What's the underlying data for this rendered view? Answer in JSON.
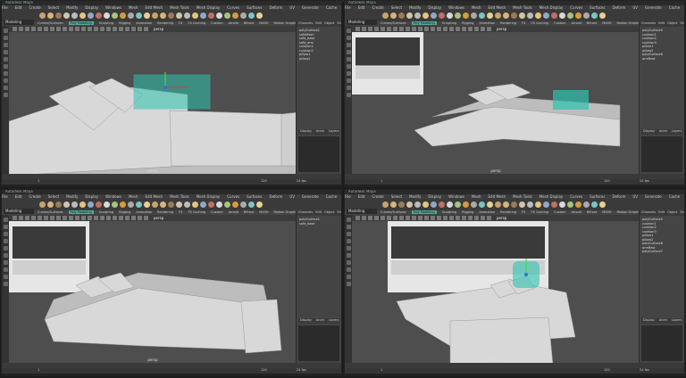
{
  "app": {
    "title_text": "Autodesk Maya",
    "mode": "Modeling",
    "menu": [
      "File",
      "Edit",
      "Create",
      "Select",
      "Modify",
      "Display",
      "Windows",
      "Mesh",
      "Edit Mesh",
      "Mesh Tools",
      "Mesh Display",
      "Curves",
      "Surfaces",
      "Deform",
      "UV",
      "Generate",
      "Cache",
      "Arnold",
      "Help"
    ],
    "shelf_tabs": [
      "Curves/Surfaces",
      "Poly Modeling",
      "Sculpting",
      "Rigging",
      "Animation",
      "Rendering",
      "FX",
      "FX Caching",
      "Custom",
      "Arnold",
      "Bifrost",
      "MASH",
      "Motion Graphics",
      "XGen"
    ],
    "active_shelf": "Poly Modeling",
    "camera": "persp",
    "channel_tabs": [
      "Channels",
      "Edit",
      "Object",
      "Show"
    ],
    "layer_tabs": [
      "Display",
      "Anim"
    ],
    "layer_menu": [
      "Layers",
      "Options",
      "Help"
    ],
    "range_start": "1",
    "range_end": "120",
    "fps": "24 fps"
  },
  "panes": [
    {
      "id": "top-left",
      "object_list": [
        "polySurface1",
        "sofaMesh",
        "sofa_base",
        "sofa_arm",
        "cushion1",
        "cushion2",
        "pillow1",
        "pillow2"
      ]
    },
    {
      "id": "top-right",
      "object_list": [
        "polySurface5",
        "cushion1",
        "cushion2",
        "cushion3",
        "pillow1",
        "pillow2",
        "polySurface6",
        "armRest"
      ]
    },
    {
      "id": "bottom-left",
      "object_list": [
        "polySurface1",
        "sofa_base"
      ]
    },
    {
      "id": "bottom-right",
      "object_list": [
        "polySurface5",
        "cushion1",
        "cushion2",
        "cushion3",
        "pillow1",
        "pillow2",
        "polySurface6",
        "armRest",
        "polySurface7"
      ]
    }
  ],
  "colors": {
    "viewport": "#4e4e4e",
    "sofa": "#d8d8d8",
    "selection": "#2fc3b0",
    "manip_red": "#e23b3b",
    "manip_green": "#3ce23c",
    "manip_blue": "#3b6be2"
  }
}
